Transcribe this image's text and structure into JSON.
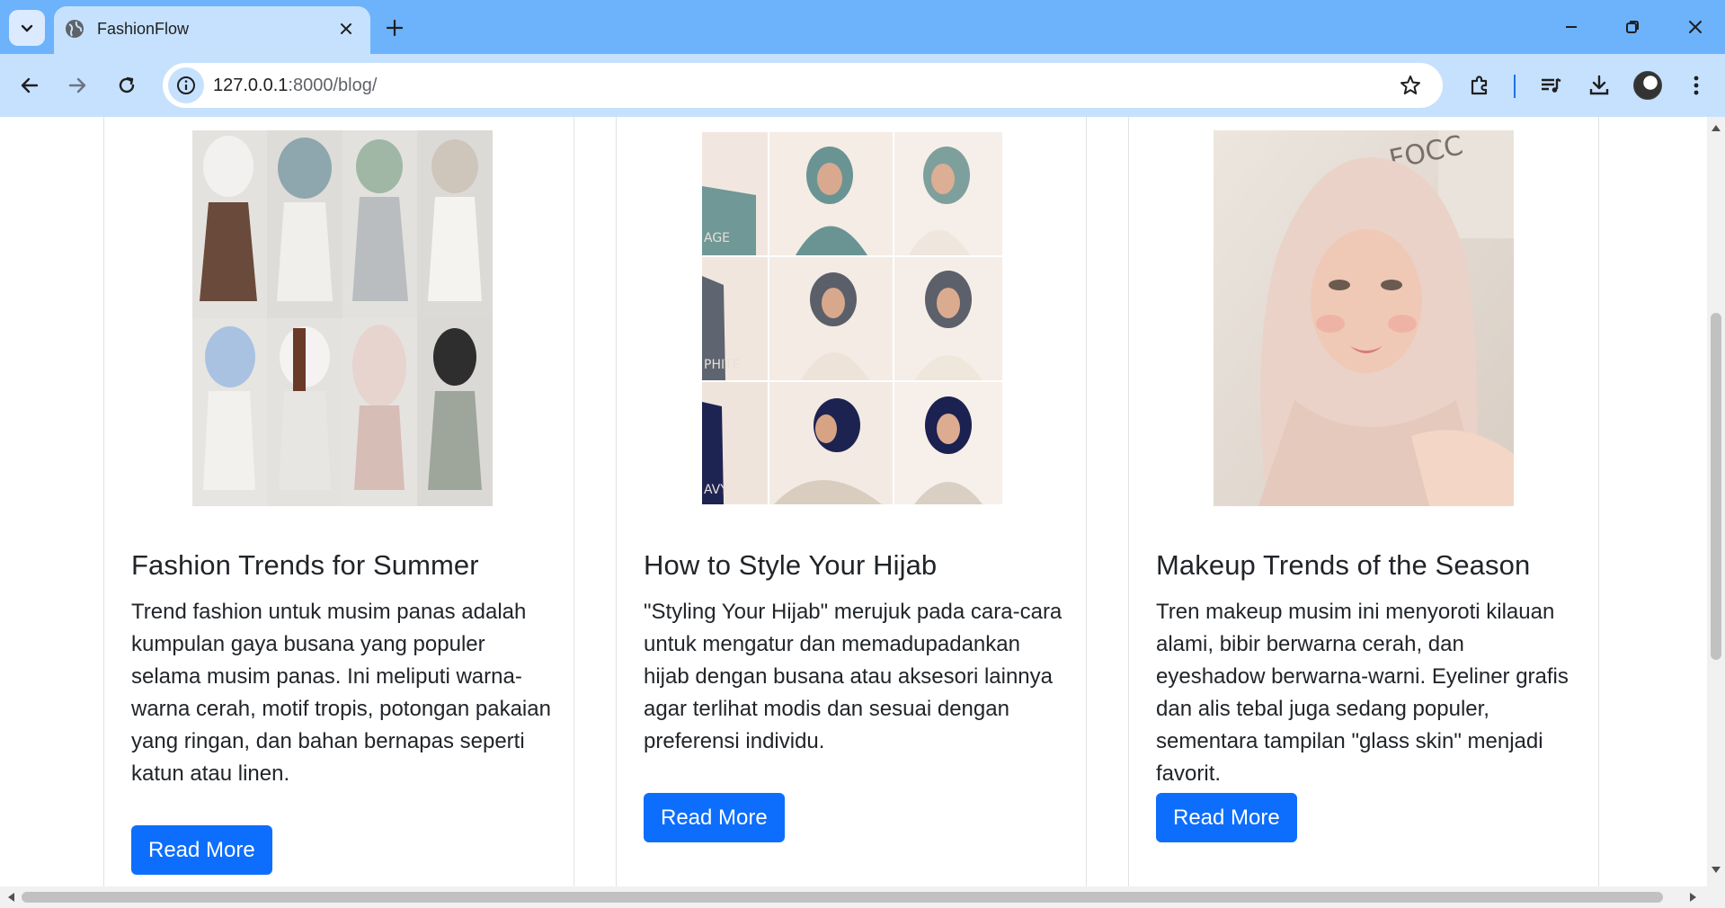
{
  "browser": {
    "tab_title": "FashionFlow",
    "url_host": "127.0.0.1",
    "url_rest": ":8000/blog/"
  },
  "colors": {
    "chrome_tabstrip": "#6cb3fb",
    "chrome_toolbar": "#c6e1fd",
    "button_primary": "#0d6efd",
    "text_dark": "#212529"
  },
  "cards": [
    {
      "title": "Fashion Trends for Summer",
      "text": "Trend fashion untuk musim panas adalah kumpulan gaya busana yang populer selama musim panas. Ini meliputi warna-warna cerah, motif tropis, potongan pakaian yang ringan, dan bahan bernapas seperti katun atau linen.",
      "button": "Read More"
    },
    {
      "title": "How to Style Your Hijab",
      "text": "\"Styling Your Hijab\" merujuk pada cara-cara untuk mengatur dan memadupadankan hijab dengan busana atau aksesori lainnya agar terlihat modis dan sesuai dengan preferensi individu.",
      "button": "Read More",
      "image_labels": [
        "AGE",
        "PHITE",
        "AVY"
      ]
    },
    {
      "title": "Makeup Trends of the Season",
      "text": "Tren makeup musim ini menyoroti kilauan alami, bibir berwarna cerah, dan eyeshadow berwarna-warni. Eyeliner grafis dan alis tebal juga sedang populer, sementara tampilan \"glass skin\" menjadi favorit.",
      "button": "Read More",
      "image_labels": [
        "FOCC"
      ]
    }
  ]
}
